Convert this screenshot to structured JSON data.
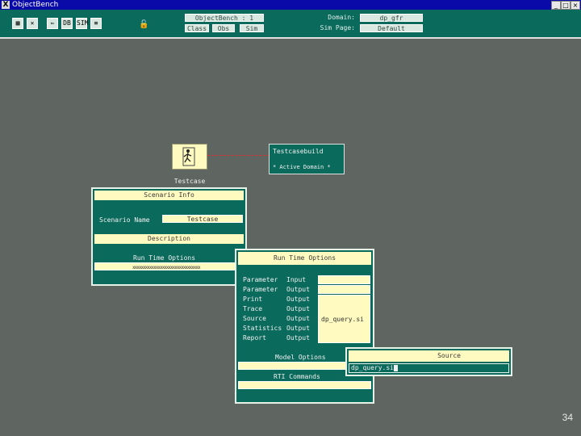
{
  "window": {
    "title": "ObjectBench",
    "controls": [
      "_",
      "□",
      "×"
    ]
  },
  "toolbar": {
    "icons": [
      "DB",
      "OB",
      "SIM",
      "≡"
    ],
    "bench_name": "ObjectBench : 1",
    "buttons": [
      "Class",
      "Obs",
      "Sim"
    ],
    "domain_label": "Domain:",
    "domain_value": "dp_gfr",
    "sim_page_label": "Sim Page:",
    "sim_page_value": "Default"
  },
  "canvas": {
    "node_icon_label": "Testcase",
    "node_box": {
      "title": "Testcasebuild",
      "subtitle": "* Active Domain *"
    }
  },
  "scenario_panel": {
    "title": "Scenario Info",
    "name_label": "Scenario Name",
    "name_value": "Testcase",
    "description_label": "Description",
    "runtime_label": "Run Time Options",
    "runtime_pattern": "xxxxxxxxxxxxxxxxxxxxxxxxxxxxxxxx"
  },
  "runtime_panel": {
    "title": "Run Time Options",
    "options": [
      {
        "name": "Parameter",
        "mode": "Input",
        "value": ""
      },
      {
        "name": "Parameter",
        "mode": "Output",
        "value": ""
      },
      {
        "name": "Print",
        "mode": "Output",
        "value": ""
      },
      {
        "name": "Trace",
        "mode": "Output",
        "value": ""
      },
      {
        "name": "Source",
        "mode": "Output",
        "value": "dp_query.si"
      },
      {
        "name": "Statistics",
        "mode": "Output",
        "value": ""
      },
      {
        "name": "Report",
        "mode": "Output",
        "value": ""
      }
    ],
    "model_options_label": "Model Options",
    "rti_commands_label": "RTI Commands"
  },
  "source_panel": {
    "title": "Source",
    "value": "dp_query.si"
  },
  "slide": {
    "page_number": "34"
  },
  "colors": {
    "title_bar": "#0a0aa8",
    "panel_green": "#0a6a5c",
    "field_yellow": "#fffbc0",
    "desktop": "#5f6560",
    "link_red": "#e03030"
  }
}
